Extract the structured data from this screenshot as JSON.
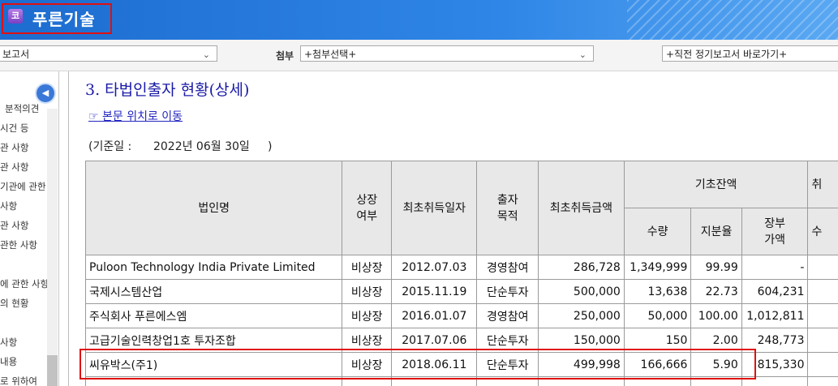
{
  "header": {
    "logo_glyph": "코",
    "company": "푸른기술"
  },
  "toolbar": {
    "report_select": "보고서",
    "attach_label": "첨부",
    "attach_select": "+첨부선택+",
    "goto_select": "+직전 정기보고서 바로가기+"
  },
  "sidebar": {
    "items": [
      "분적의견",
      "시건 등",
      "관 사항",
      "관 사항",
      "기관에 관한",
      "사항",
      "관 사항",
      "관한 사항",
      "에 관한 사항",
      "의 현황",
      "사항",
      "내용",
      "로 위하여"
    ]
  },
  "section": {
    "title": "3. 타법인출자 현황(상세)",
    "goto_link": "☞ 본문 위치로 이동",
    "basis": "(기준일 :      2022년 06월 30일     )"
  },
  "table": {
    "headers": {
      "name": "법인명",
      "listed": "상장\n여부",
      "first_date": "최초취득일자",
      "purpose": "출자\n목적",
      "first_amount": "최초취득금액",
      "opening": "기초잔액",
      "qty": "수량",
      "ratio": "지분율",
      "book": "장부\n가액",
      "extra_top": "취",
      "extra_sub": "수"
    },
    "rows": [
      {
        "name": "Puloon Technology India Private Limited",
        "listed": "비상장",
        "date": "2012.07.03",
        "purpose": "경영참여",
        "amount": "286,728",
        "qty": "1,349,999",
        "ratio": "99.99",
        "book": "-"
      },
      {
        "name": "국제시스템산업",
        "listed": "비상장",
        "date": "2015.11.19",
        "purpose": "단순투자",
        "amount": "500,000",
        "qty": "13,638",
        "ratio": "22.73",
        "book": "604,231"
      },
      {
        "name": "주식회사 푸른에스엠",
        "listed": "비상장",
        "date": "2016.01.07",
        "purpose": "경영참여",
        "amount": "250,000",
        "qty": "50,000",
        "ratio": "100.00",
        "book": "1,012,811"
      },
      {
        "name": "고급기술인력창업1호 투자조합",
        "listed": "비상장",
        "date": "2017.07.06",
        "purpose": "단순투자",
        "amount": "150,000",
        "qty": "150",
        "ratio": "2.00",
        "book": "248,773"
      },
      {
        "name": "씨유박스(주1)",
        "listed": "비상장",
        "date": "2018.06.11",
        "purpose": "단순투자",
        "amount": "499,998",
        "qty": "166,666",
        "ratio": "5.90",
        "book": "815,330"
      }
    ]
  }
}
